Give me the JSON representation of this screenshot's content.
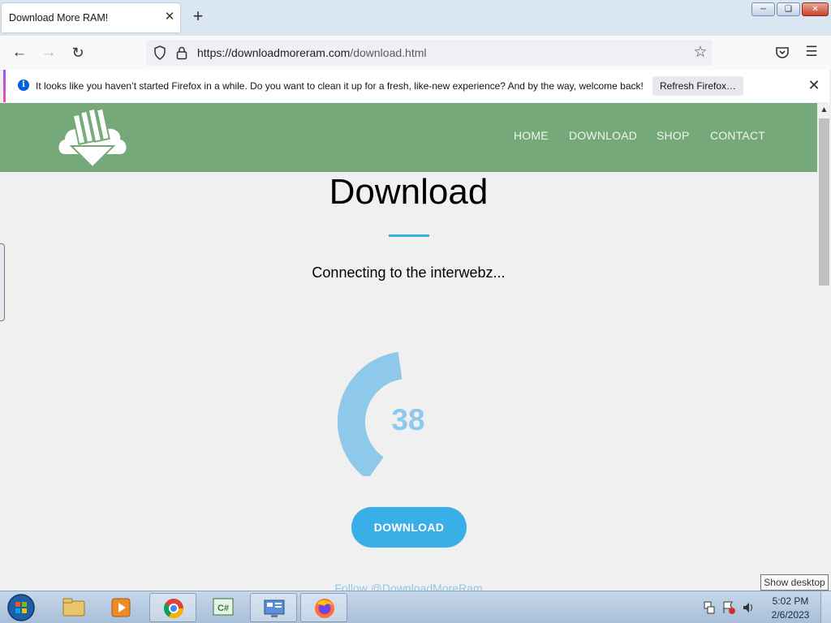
{
  "browser": {
    "tab_title": "Download More RAM!",
    "tab_close": "✕",
    "new_tab": "+",
    "url_domain": "https://downloadmoreram.com",
    "url_path": "/download.html",
    "icons": [
      "back-arrow-icon",
      "forward-arrow-icon",
      "reload-icon",
      "shield-icon",
      "lock-icon",
      "star-icon",
      "pocket-icon",
      "hamburger-menu-icon"
    ]
  },
  "notification": {
    "text": "It looks like you haven’t started Firefox in a while. Do you want to clean it up for a fresh, like-new experience? And by the way, welcome back!",
    "button": "Refresh Firefox…",
    "close": "✕"
  },
  "site": {
    "header_color": "#76a979",
    "nav": [
      "HOME",
      "DOWNLOAD",
      "SHOP",
      "CONTACT"
    ],
    "title": "Download",
    "status": "Connecting to the interwebz...",
    "progress": 38,
    "download_button": "DOWNLOAD",
    "follow": "Follow @DownloadMoreRam",
    "accent_color": "#3aaee6"
  },
  "taskbar": {
    "apps": [
      "file-explorer",
      "media-player",
      "chrome",
      "csharp-editor",
      "control-panel",
      "firefox"
    ],
    "time": "5:02 PM",
    "date": "2/6/2023",
    "show_desktop": "Show desktop"
  }
}
